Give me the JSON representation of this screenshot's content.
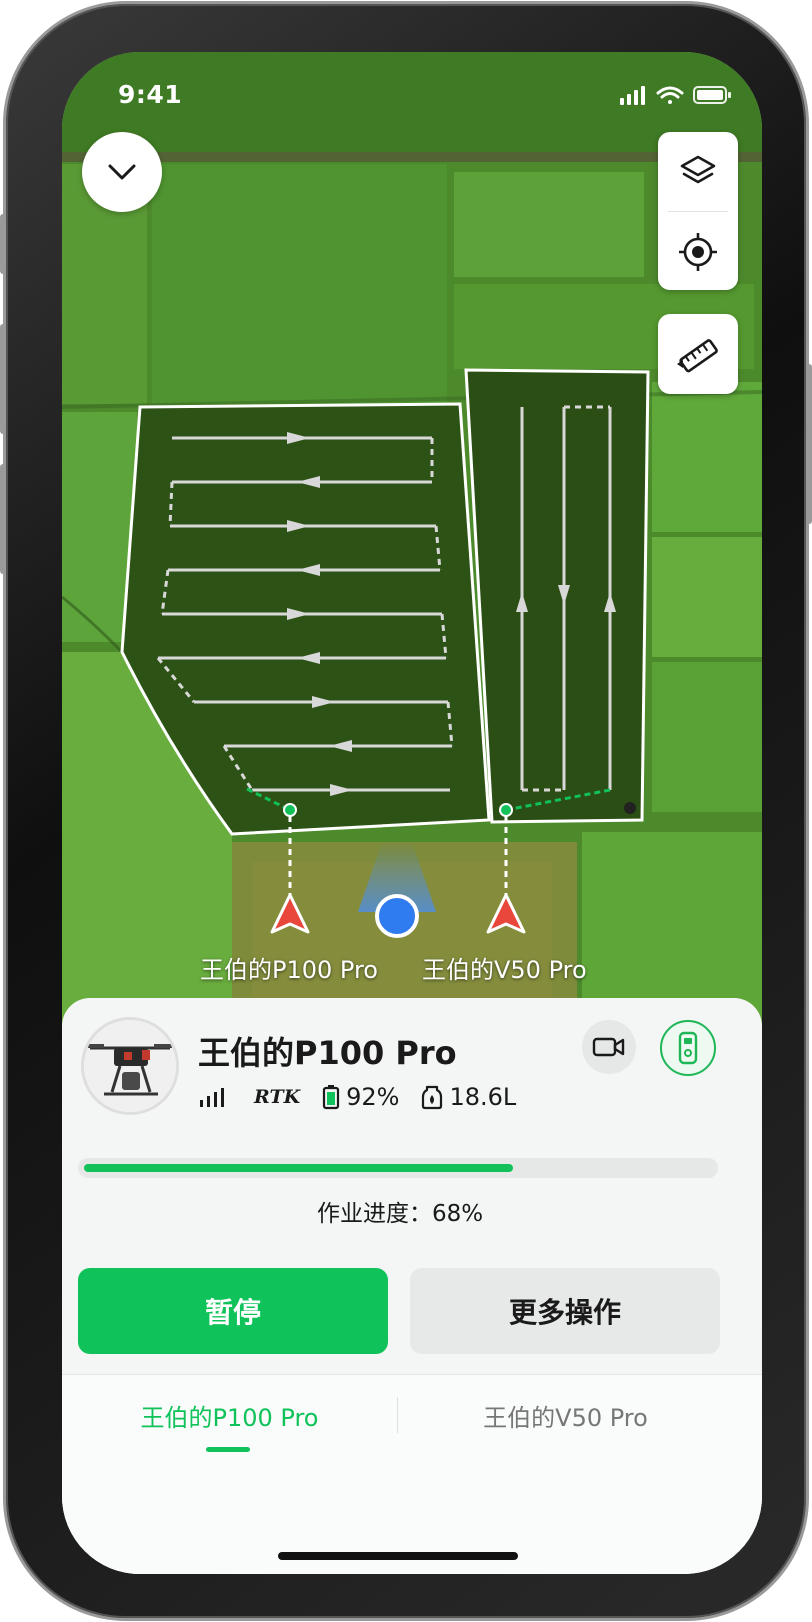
{
  "status_bar": {
    "time": "9:41"
  },
  "map": {
    "drones": [
      {
        "label": "王伯的P100 Pro"
      },
      {
        "label": "王伯的V50 Pro"
      }
    ]
  },
  "panel": {
    "drone_name": "王伯的P100 Pro",
    "rtk_label": "RTK",
    "battery": "92%",
    "tank": "18.6L",
    "progress": {
      "percent": 68,
      "label": "作业进度：68%"
    },
    "pause_label": "暂停",
    "more_label": "更多操作"
  },
  "tabs": [
    {
      "label": "王伯的P100 Pro",
      "active": true
    },
    {
      "label": "王伯的V50 Pro",
      "active": false
    }
  ],
  "colors": {
    "accent": "#10c25a",
    "warning_marker": "#e9473b",
    "operator_dot": "#2f7bf0"
  }
}
